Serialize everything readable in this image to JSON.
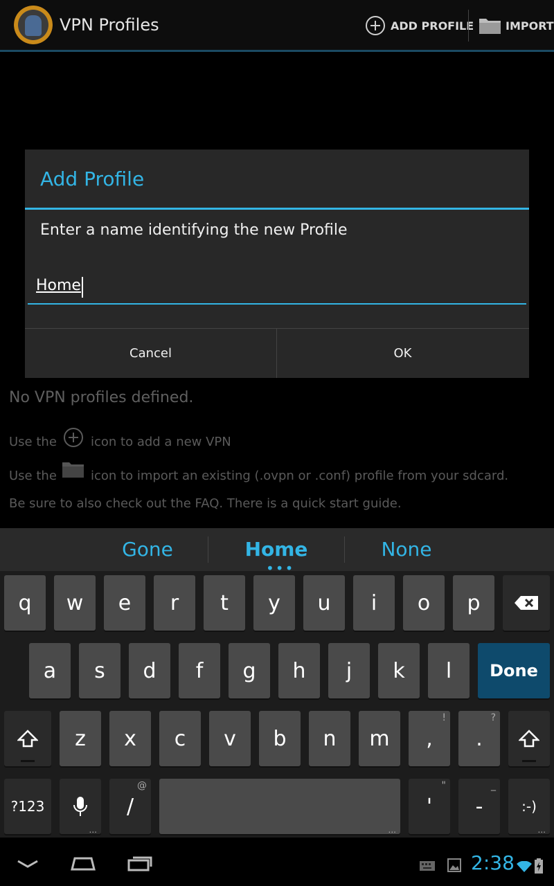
{
  "action_bar": {
    "title": "VPN Profiles",
    "add_profile_label": "ADD PROFILE",
    "import_label": "IMPORT"
  },
  "background": {
    "empty_title": "No VPN profiles defined.",
    "hint1_before": "Use the",
    "hint1_after": "icon to add a new VPN",
    "hint2_before": "Use the",
    "hint2_after": "icon to import an existing (.ovpn or .conf) profile from your sdcard.",
    "hint3": "Be sure to also check out the FAQ. There is a quick start guide."
  },
  "dialog": {
    "title": "Add Profile",
    "message": "Enter a name identifying the new Profile",
    "input_value": "Home",
    "cancel_label": "Cancel",
    "ok_label": "OK"
  },
  "suggestions": {
    "items": [
      "Gone",
      "Home",
      "None"
    ],
    "more_indicator": "•••"
  },
  "keyboard": {
    "row1": [
      "q",
      "w",
      "e",
      "r",
      "t",
      "y",
      "u",
      "i",
      "o",
      "p"
    ],
    "row2": [
      "a",
      "s",
      "d",
      "f",
      "g",
      "h",
      "j",
      "k",
      "l"
    ],
    "row3": [
      "z",
      "x",
      "c",
      "v",
      "b",
      "n",
      "m",
      ",",
      "."
    ],
    "done_label": "Done",
    "symbols_label": "?123",
    "slash_label": "/",
    "slash_hint": "@",
    "comma_hint": "!",
    "period_hint": "?",
    "apostrophe_label": "'",
    "apostrophe_hint": "\"",
    "dash_label": "-",
    "dash_hint": "_",
    "smiley_label": ":-)",
    "dots": "..."
  },
  "status": {
    "time": "2:38"
  },
  "colors": {
    "accent": "#33b5e5",
    "done_key": "#0e4a6c"
  }
}
